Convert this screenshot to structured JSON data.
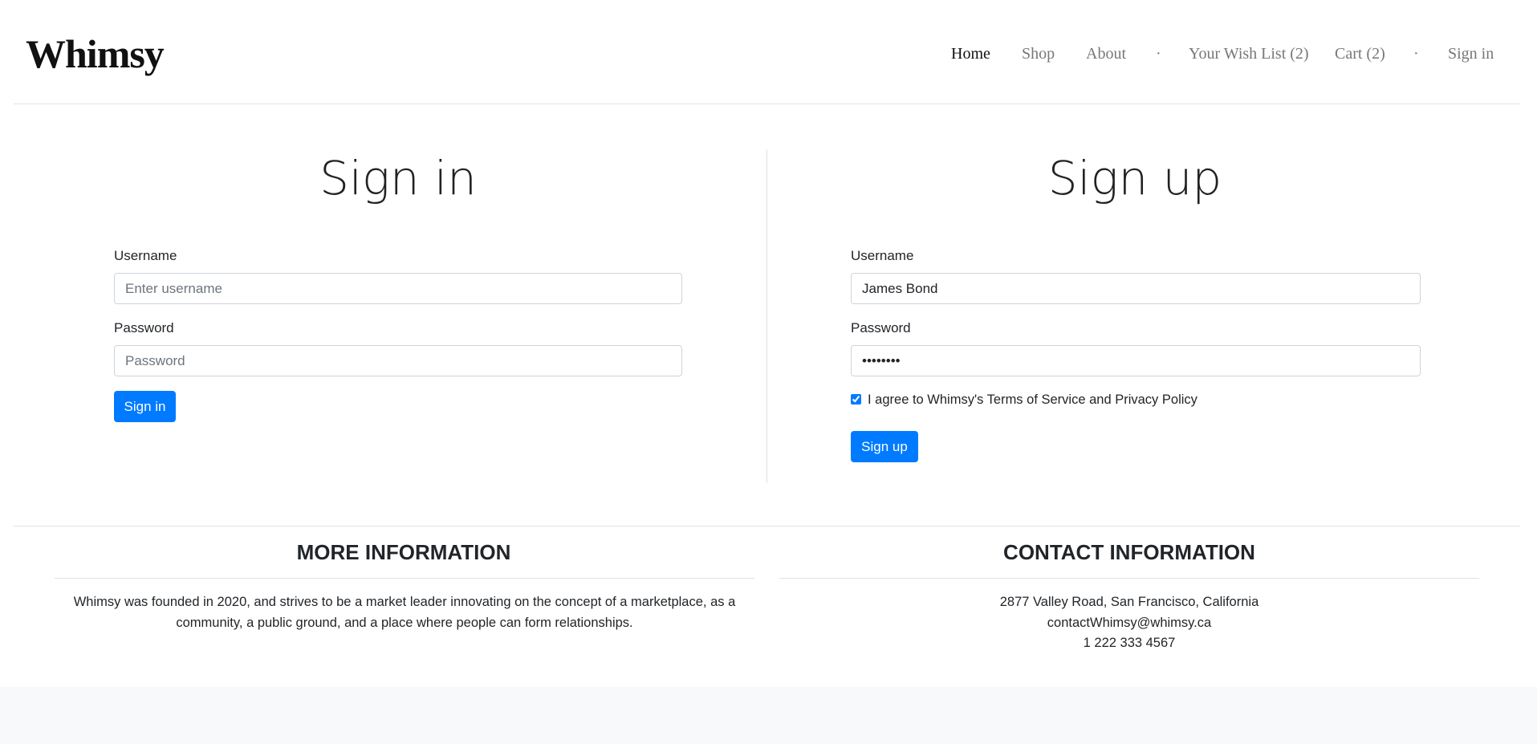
{
  "header": {
    "logo": "Whimsy",
    "nav": [
      {
        "label": "Home",
        "active": true
      },
      {
        "label": "Shop"
      },
      {
        "label": "About"
      },
      {
        "label": "·"
      },
      {
        "label": "Your Wish List (2)"
      },
      {
        "label": "Cart (2)"
      },
      {
        "label": "·"
      },
      {
        "label": "Sign in"
      }
    ]
  },
  "signin": {
    "title": "Sign in",
    "username_label": "Username",
    "username_placeholder": "Enter username",
    "password_label": "Password",
    "password_placeholder": "Password",
    "button": "Sign in"
  },
  "signup": {
    "title": "Sign up",
    "username_label": "Username",
    "username_value": "James Bond",
    "password_label": "Password",
    "password_value": "••••••••",
    "agree_checked": true,
    "agree_label": "I agree to Whimsy's Terms of Service and Privacy Policy",
    "button": "Sign up"
  },
  "footer": {
    "more": {
      "heading": "MORE INFORMATION",
      "lines": [
        "Whimsy was founded in 2020, and strives to be a market leader innovating on the concept of a marketplace, as a",
        "community, a public ground, and a place where people can form relationships."
      ]
    },
    "contact": {
      "heading": "CONTACT INFORMATION",
      "lines": [
        "2877 Valley Road, San Francisco, California",
        "contactWhimsy@whimsy.ca",
        "1 222 333 4567"
      ]
    }
  },
  "colors": {
    "primary": "#007bff",
    "band": "#f8f9fa"
  }
}
